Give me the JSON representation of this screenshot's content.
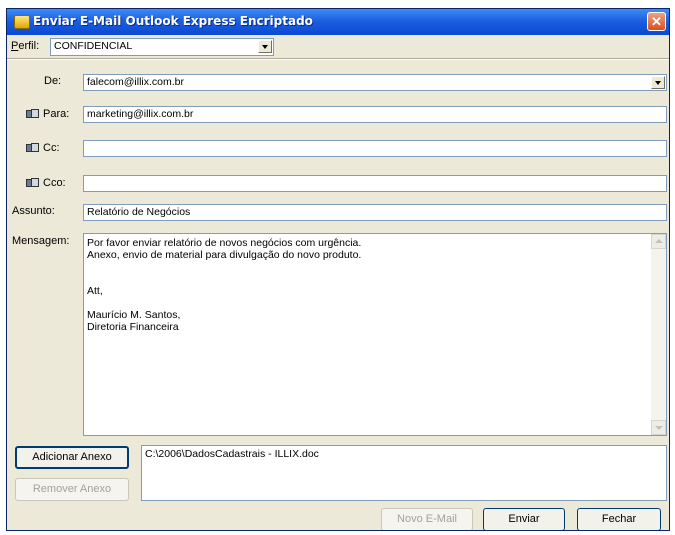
{
  "window": {
    "title": "Enviar E-Mail Outlook Express Encriptado",
    "close_glyph": "✕"
  },
  "profile": {
    "label": "Perfil:",
    "value": "CONFIDENCIAL"
  },
  "from": {
    "label": "De:",
    "value": "falecom@illix.com.br"
  },
  "to": {
    "label": "Para:",
    "value": "marketing@illix.com.br"
  },
  "cc": {
    "label": "Cc:",
    "value": ""
  },
  "bcc": {
    "label": "Cco:",
    "value": ""
  },
  "subject": {
    "label": "Assunto:",
    "value": "Relatório de Negócios"
  },
  "message": {
    "label": "Mensagem:",
    "lines": [
      "Por favor enviar relatório de novos negócios com urgência.",
      "Anexo, envio de material para divulgação do novo produto.",
      "",
      "",
      "Att,",
      "",
      "Maurício M. Santos,",
      "Diretoria Financeira"
    ]
  },
  "attachments": {
    "add_button": "Adicionar Anexo",
    "remove_button": "Remover Anexo",
    "items": [
      "C:\\2006\\DadosCadastrais - ILLIX.doc"
    ]
  },
  "footer": {
    "new_email_button": "Novo E-Mail",
    "send_button": "Enviar",
    "close_button": "Fechar"
  },
  "icons": {
    "address_book": "address-book-icon",
    "app": "envelope-app-icon"
  },
  "colors": {
    "titlebar": "#0a49d4",
    "window_bg": "#ece9d8",
    "close_button": "#d8501c",
    "field_border": "#7f9db9"
  }
}
